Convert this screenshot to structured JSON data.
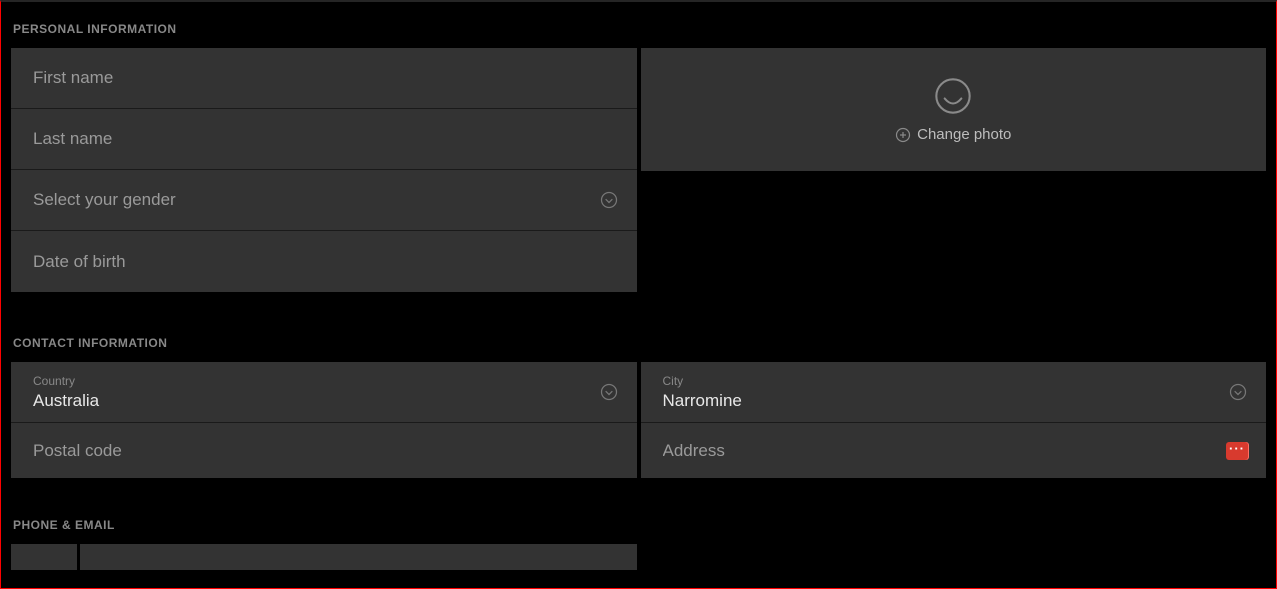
{
  "sections": {
    "personal": {
      "title": "PERSONAL INFORMATION",
      "first_name_placeholder": "First name",
      "last_name_placeholder": "Last name",
      "gender_placeholder": "Select your gender",
      "dob_placeholder": "Date of birth",
      "change_photo_label": "Change photo"
    },
    "contact": {
      "title": "CONTACT INFORMATION",
      "country_label": "Country",
      "country_value": "Australia",
      "city_label": "City",
      "city_value": "Narromine",
      "postal_placeholder": "Postal code",
      "address_placeholder": "Address"
    },
    "phone": {
      "title": "PHONE & EMAIL"
    }
  }
}
